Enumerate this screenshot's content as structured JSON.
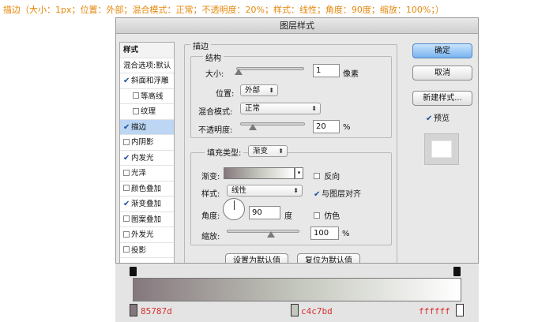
{
  "caption": "描边（大小：1px；位置：外部；混合模式：正常；不透明度：20%；样式：线性；角度：90度；缩放：100%；）",
  "dialog": {
    "title": "图层样式",
    "left_list": {
      "header": "样式",
      "items": [
        {
          "label": "混合选项:默认",
          "checked": false,
          "sub": false,
          "plain": true
        },
        {
          "label": "斜面和浮雕",
          "checked": true,
          "sub": false
        },
        {
          "label": "等高线",
          "checked": false,
          "sub": true
        },
        {
          "label": "纹理",
          "checked": false,
          "sub": true
        },
        {
          "label": "描边",
          "checked": true,
          "sub": false,
          "active": true
        },
        {
          "label": "内阴影",
          "checked": false,
          "sub": false
        },
        {
          "label": "内发光",
          "checked": true,
          "sub": false
        },
        {
          "label": "光泽",
          "checked": false,
          "sub": false
        },
        {
          "label": "颜色叠加",
          "checked": false,
          "sub": false
        },
        {
          "label": "渐变叠加",
          "checked": true,
          "sub": false
        },
        {
          "label": "图案叠加",
          "checked": false,
          "sub": false
        },
        {
          "label": "外发光",
          "checked": false,
          "sub": false
        },
        {
          "label": "投影",
          "checked": false,
          "sub": false
        }
      ]
    },
    "stroke": {
      "title": "描边",
      "structure_title": "结构",
      "size_label": "大小:",
      "size_value": "1",
      "size_unit": "像素",
      "size_level": 0.01,
      "position_label": "位置:",
      "position_value": "外部",
      "blend_label": "混合模式:",
      "blend_value": "正常",
      "opacity_label": "不透明度:",
      "opacity_value": "20",
      "opacity_unit": "%",
      "opacity_level": 0.2,
      "fill_type_label": "填充类型:",
      "fill_type_value": "渐变",
      "gradient_label": "渐变:",
      "reverse_label": "反向",
      "style_label": "样式:",
      "style_value": "线性",
      "align_label": "与图层对齐",
      "angle_label": "角度:",
      "angle_value": "90",
      "angle_unit": "度",
      "dither_label": "仿色",
      "scale_label": "缩放:",
      "scale_value": "100",
      "scale_unit": "%",
      "scale_level": 0.5,
      "reset_default": "设置为默认值",
      "restore_default": "复位为默认值"
    },
    "buttons": {
      "ok": "确定",
      "cancel": "取消",
      "new_style": "新建样式...",
      "preview": "预览"
    }
  },
  "gradient_editor": {
    "colors": [
      "#85787d",
      "#c4c7bd",
      "#ffffff"
    ],
    "stops": [
      {
        "label": "85787d"
      },
      {
        "label": "c4c7bd"
      },
      {
        "label": "ffffff"
      }
    ]
  },
  "colors": {
    "caption": "#e5870a",
    "stop_label": "#d8322f",
    "primary_button": "#79b3ee",
    "active_item": "#bcd6f4"
  }
}
